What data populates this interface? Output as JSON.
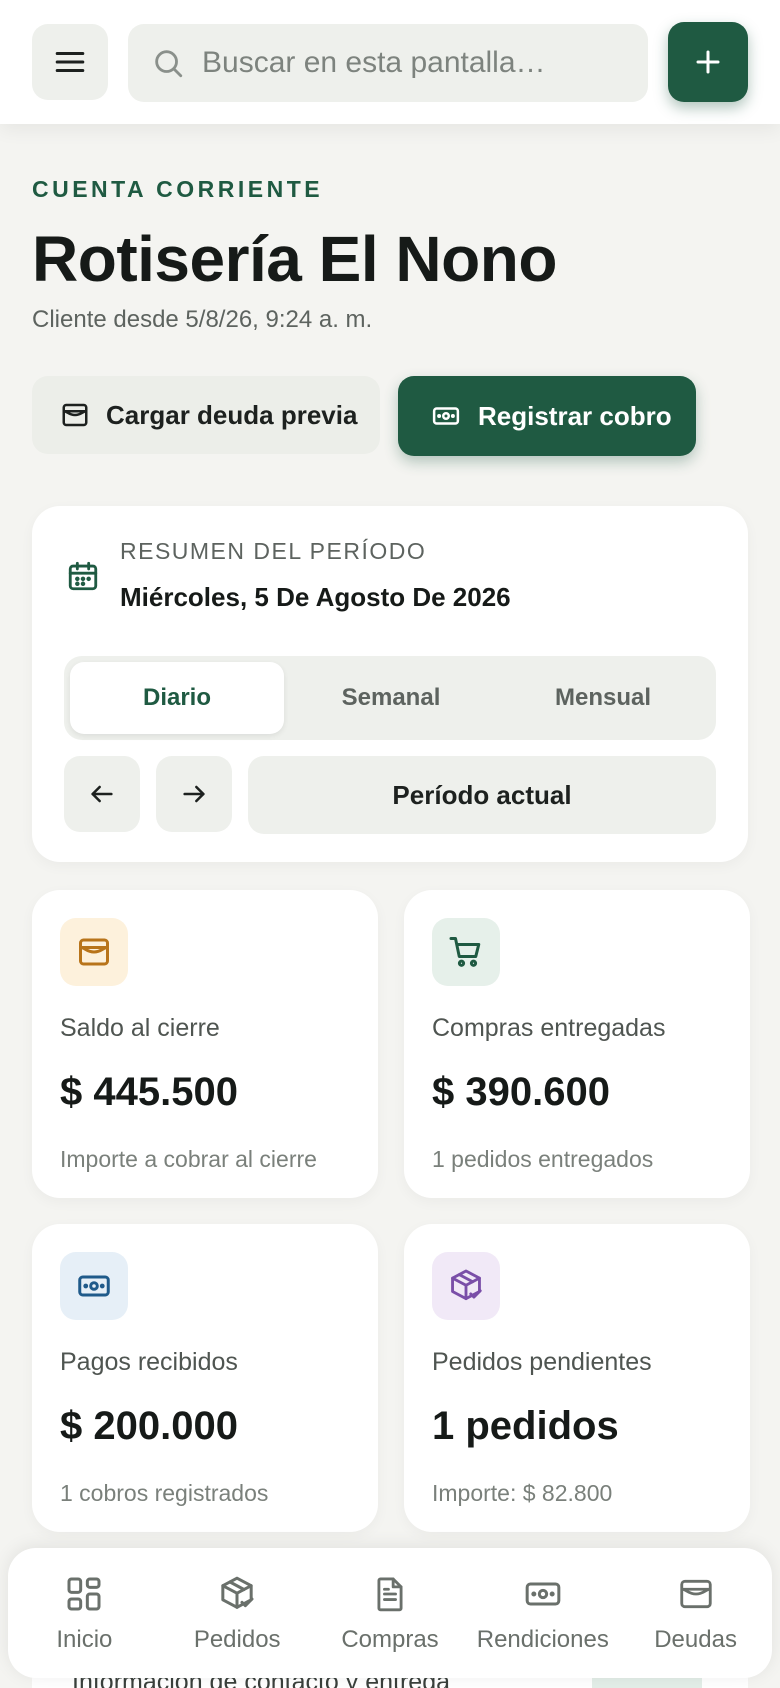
{
  "search": {
    "placeholder": "Buscar en esta pantalla…"
  },
  "header": {
    "eyebrow": "CUENTA CORRIENTE",
    "title": "Rotisería El Nono",
    "subtitle": "Cliente desde 5/8/26, 9:24 a. m."
  },
  "actions": {
    "load_debt": "Cargar deuda previa",
    "register_payment": "Registrar cobro"
  },
  "period": {
    "label": "RESUMEN DEL PERÍODO",
    "date": "Miércoles, 5 De Agosto De 2026",
    "tabs": [
      "Diario",
      "Semanal",
      "Mensual"
    ],
    "active_tab": "Diario",
    "current_button": "Período actual"
  },
  "stats": [
    {
      "icon": "wallet-icon",
      "label": "Saldo al cierre",
      "value": "$ 445.500",
      "note": "Importe a cobrar al cierre",
      "color": "#b8741a",
      "bg": "#fdf1dc"
    },
    {
      "icon": "cart-icon",
      "label": "Compras entregadas",
      "value": "$ 390.600",
      "note": "1 pedidos entregados",
      "color": "#1f5a42",
      "bg": "#e6f0ea"
    },
    {
      "icon": "cash-icon",
      "label": "Pagos recibidos",
      "value": "$ 200.000",
      "note": "1 cobros registrados",
      "color": "#1f5a8a",
      "bg": "#e6eff7"
    },
    {
      "icon": "package-check-icon",
      "label": "Pedidos pendientes",
      "value": "1 pedidos",
      "note": "Importe: $ 82.800",
      "color": "#7a4ea8",
      "bg": "#f1e9f7"
    }
  ],
  "peek": {
    "text": "Información de contacto y entrega"
  },
  "bottom_nav": [
    {
      "icon": "grid-icon",
      "label": "Inicio"
    },
    {
      "icon": "package-icon",
      "label": "Pedidos"
    },
    {
      "icon": "document-icon",
      "label": "Compras"
    },
    {
      "icon": "cash-icon",
      "label": "Rendiciones"
    },
    {
      "icon": "wallet-icon",
      "label": "Deudas"
    }
  ],
  "colors": {
    "brand": "#1f5a42",
    "background": "#f4f4f1"
  }
}
